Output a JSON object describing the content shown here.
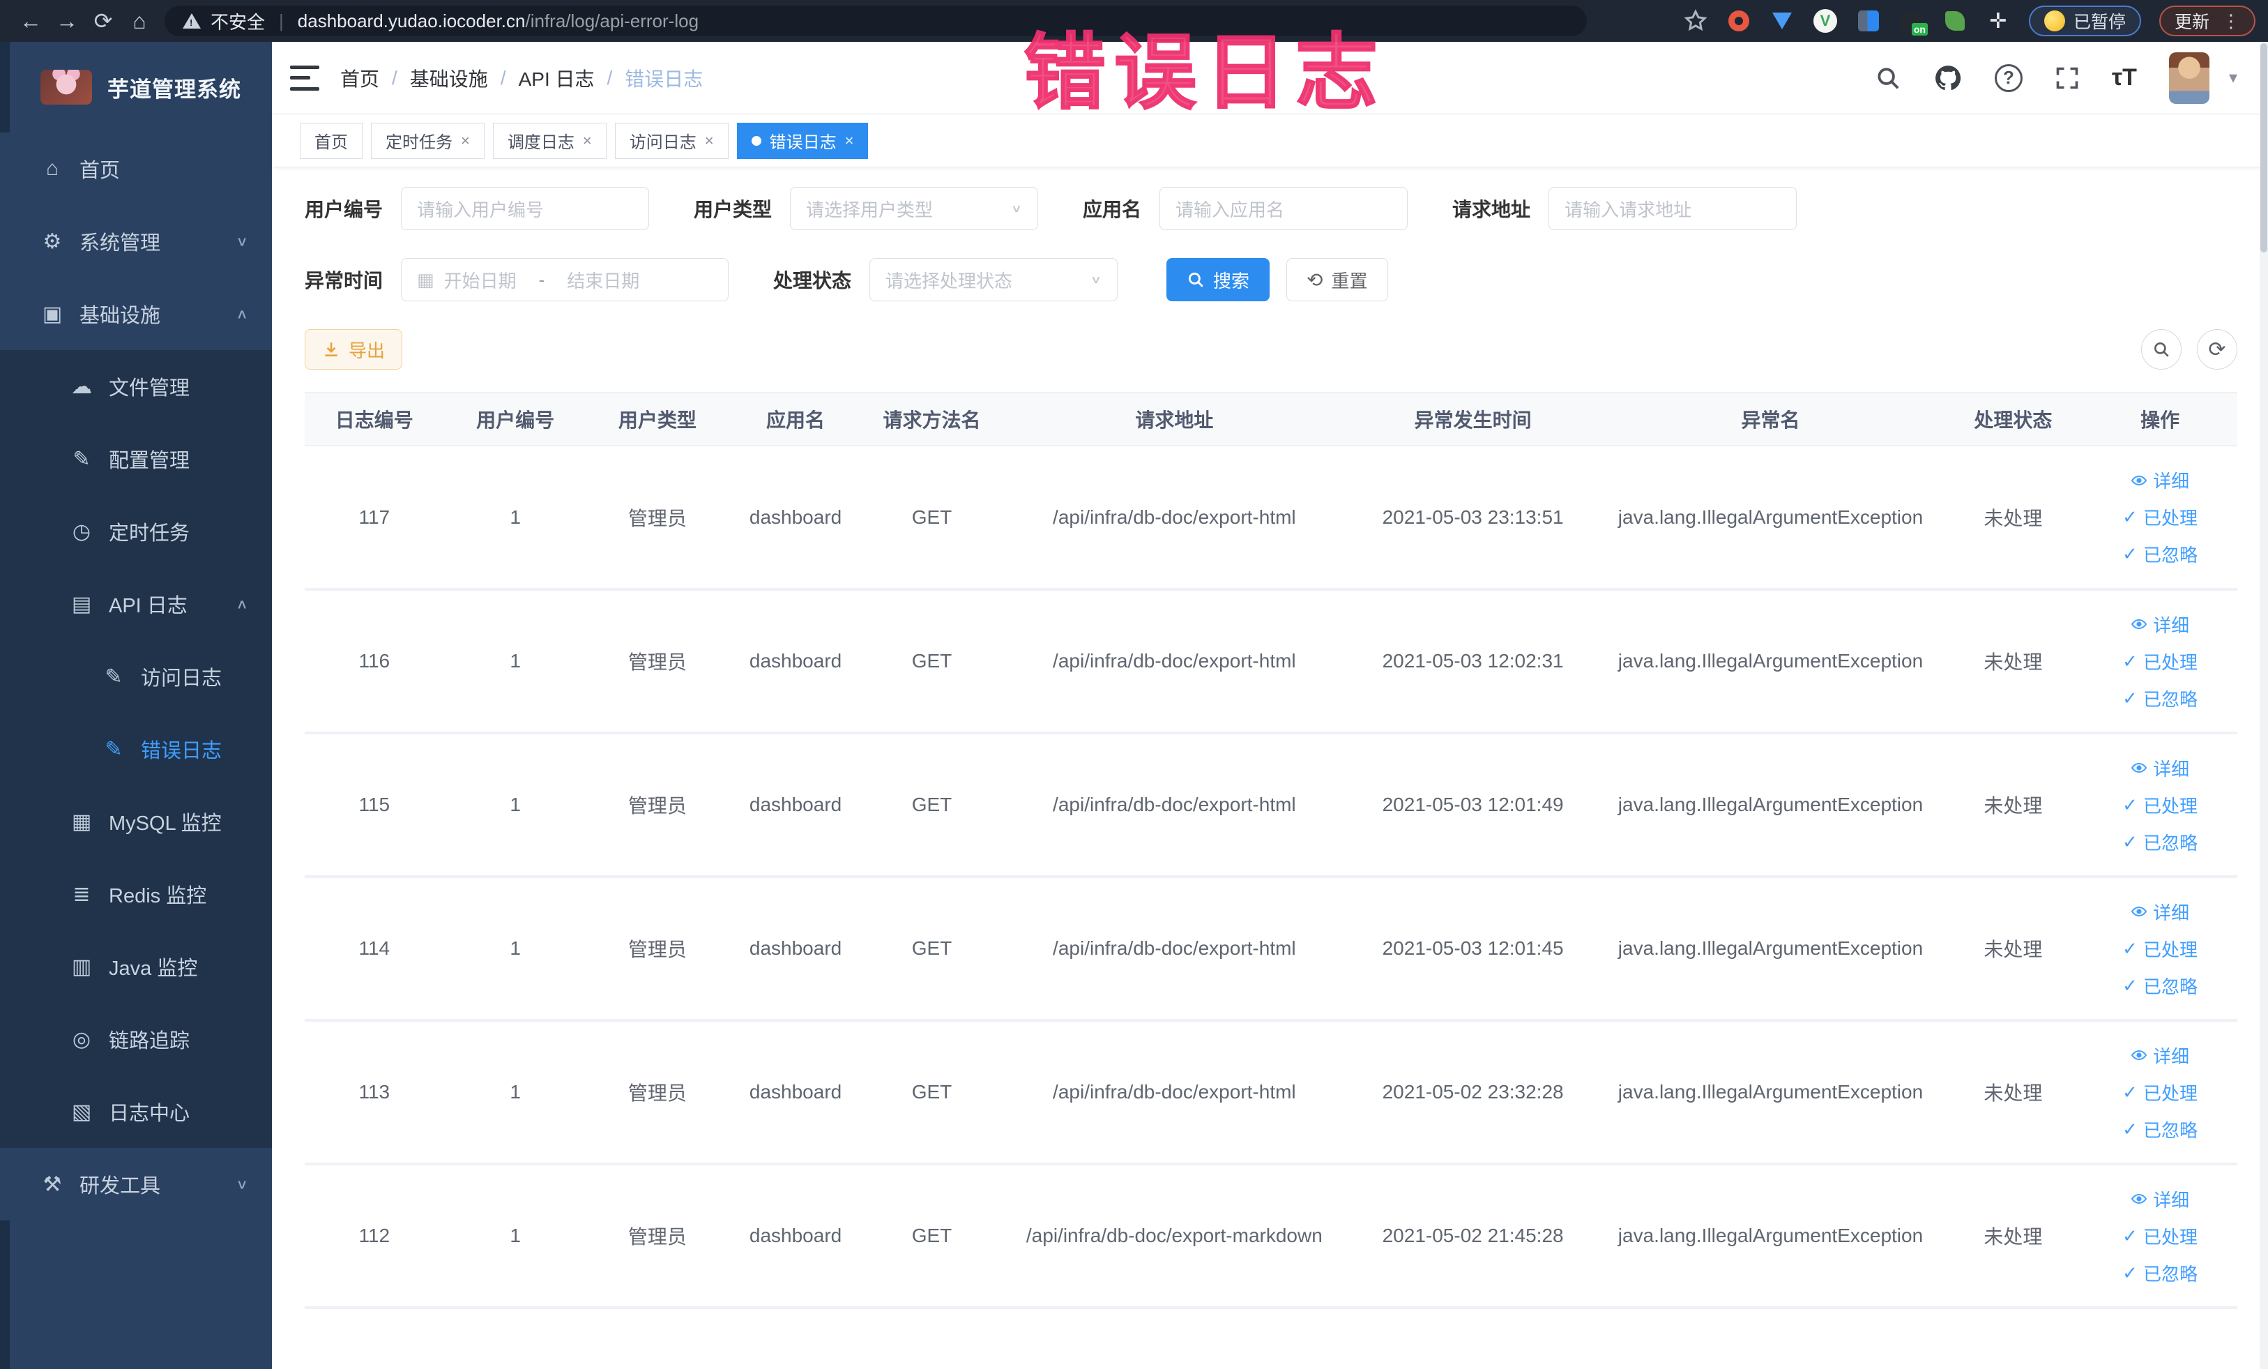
{
  "browser": {
    "security_label": "不安全",
    "url_domain": "dashboard.yudao.iocoder.cn",
    "url_path": "/infra/log/api-error-log",
    "paused_badge": "已暂停",
    "update_button": "更新"
  },
  "overlay_annotation": "错误日志",
  "sidebar": {
    "logo_title": "芋道管理系统",
    "items": [
      {
        "label": "首页",
        "icon": "home-icon",
        "level": 1
      },
      {
        "label": "系统管理",
        "icon": "gear-icon",
        "level": 1,
        "chevron": "down"
      },
      {
        "label": "基础设施",
        "icon": "monitor-icon",
        "level": 1,
        "chevron": "up"
      },
      {
        "label": "文件管理",
        "icon": "cloud-upload-icon",
        "level": 2
      },
      {
        "label": "配置管理",
        "icon": "edit-icon",
        "level": 2
      },
      {
        "label": "定时任务",
        "icon": "timer-icon",
        "level": 2
      },
      {
        "label": "API 日志",
        "icon": "api-log-icon",
        "level": 2,
        "chevron": "up"
      },
      {
        "label": "访问日志",
        "icon": "doc-edit-icon",
        "level": 3
      },
      {
        "label": "错误日志",
        "icon": "doc-edit-icon",
        "level": 3,
        "active": true
      },
      {
        "label": "MySQL 监控",
        "icon": "mysql-icon",
        "level": 2
      },
      {
        "label": "Redis 监控",
        "icon": "redis-icon",
        "level": 2
      },
      {
        "label": "Java 监控",
        "icon": "java-icon",
        "level": 2
      },
      {
        "label": "链路追踪",
        "icon": "trace-icon",
        "level": 2
      },
      {
        "label": "日志中心",
        "icon": "log-center-icon",
        "level": 2
      },
      {
        "label": "研发工具",
        "icon": "tools-icon",
        "level": 1,
        "chevron": "down"
      }
    ]
  },
  "header": {
    "breadcrumb": [
      "首页",
      "基础设施",
      "API 日志",
      "错误日志"
    ]
  },
  "tabs": [
    {
      "label": "首页",
      "closable": false,
      "active": false
    },
    {
      "label": "定时任务",
      "closable": true,
      "active": false
    },
    {
      "label": "调度日志",
      "closable": true,
      "active": false
    },
    {
      "label": "访问日志",
      "closable": true,
      "active": false
    },
    {
      "label": "错误日志",
      "closable": true,
      "active": true
    }
  ],
  "filters": {
    "user_id": {
      "label": "用户编号",
      "placeholder": "请输入用户编号"
    },
    "user_type": {
      "label": "用户类型",
      "placeholder": "请选择用户类型"
    },
    "app_name": {
      "label": "应用名",
      "placeholder": "请输入应用名"
    },
    "request_url": {
      "label": "请求地址",
      "placeholder": "请输入请求地址"
    },
    "exception_time": {
      "label": "异常时间",
      "start_placeholder": "开始日期",
      "separator": "-",
      "end_placeholder": "结束日期"
    },
    "process_status": {
      "label": "处理状态",
      "placeholder": "请选择处理状态"
    },
    "search_button": "搜索",
    "reset_button": "重置"
  },
  "toolbar": {
    "export_button": "导出"
  },
  "table": {
    "headers": [
      "日志编号",
      "用户编号",
      "用户类型",
      "应用名",
      "请求方法名",
      "请求地址",
      "异常发生时间",
      "异常名",
      "处理状态",
      "操作"
    ],
    "action_labels": [
      "详细",
      "已处理",
      "已忽略"
    ],
    "rows": [
      {
        "id": "117",
        "user_id": "1",
        "user_type": "管理员",
        "app": "dashboard",
        "method": "GET",
        "url": "/api/infra/db-doc/export-html",
        "time": "2021-05-03 23:13:51",
        "exception": "java.lang.IllegalArgumentException",
        "status": "未处理"
      },
      {
        "id": "116",
        "user_id": "1",
        "user_type": "管理员",
        "app": "dashboard",
        "method": "GET",
        "url": "/api/infra/db-doc/export-html",
        "time": "2021-05-03 12:02:31",
        "exception": "java.lang.IllegalArgumentException",
        "status": "未处理"
      },
      {
        "id": "115",
        "user_id": "1",
        "user_type": "管理员",
        "app": "dashboard",
        "method": "GET",
        "url": "/api/infra/db-doc/export-html",
        "time": "2021-05-03 12:01:49",
        "exception": "java.lang.IllegalArgumentException",
        "status": "未处理"
      },
      {
        "id": "114",
        "user_id": "1",
        "user_type": "管理员",
        "app": "dashboard",
        "method": "GET",
        "url": "/api/infra/db-doc/export-html",
        "time": "2021-05-03 12:01:45",
        "exception": "java.lang.IllegalArgumentException",
        "status": "未处理"
      },
      {
        "id": "113",
        "user_id": "1",
        "user_type": "管理员",
        "app": "dashboard",
        "method": "GET",
        "url": "/api/infra/db-doc/export-html",
        "time": "2021-05-02 23:32:28",
        "exception": "java.lang.IllegalArgumentException",
        "status": "未处理"
      },
      {
        "id": "112",
        "user_id": "1",
        "user_type": "管理员",
        "app": "dashboard",
        "method": "GET",
        "url": "/api/infra/db-doc/export-markdown",
        "time": "2021-05-02 21:45:28",
        "exception": "java.lang.IllegalArgumentException",
        "status": "未处理"
      }
    ]
  },
  "colors": {
    "accent": "#2d8cf0",
    "link": "#409eff",
    "warning": "#e6a23c",
    "annotation": "#f2477c"
  }
}
